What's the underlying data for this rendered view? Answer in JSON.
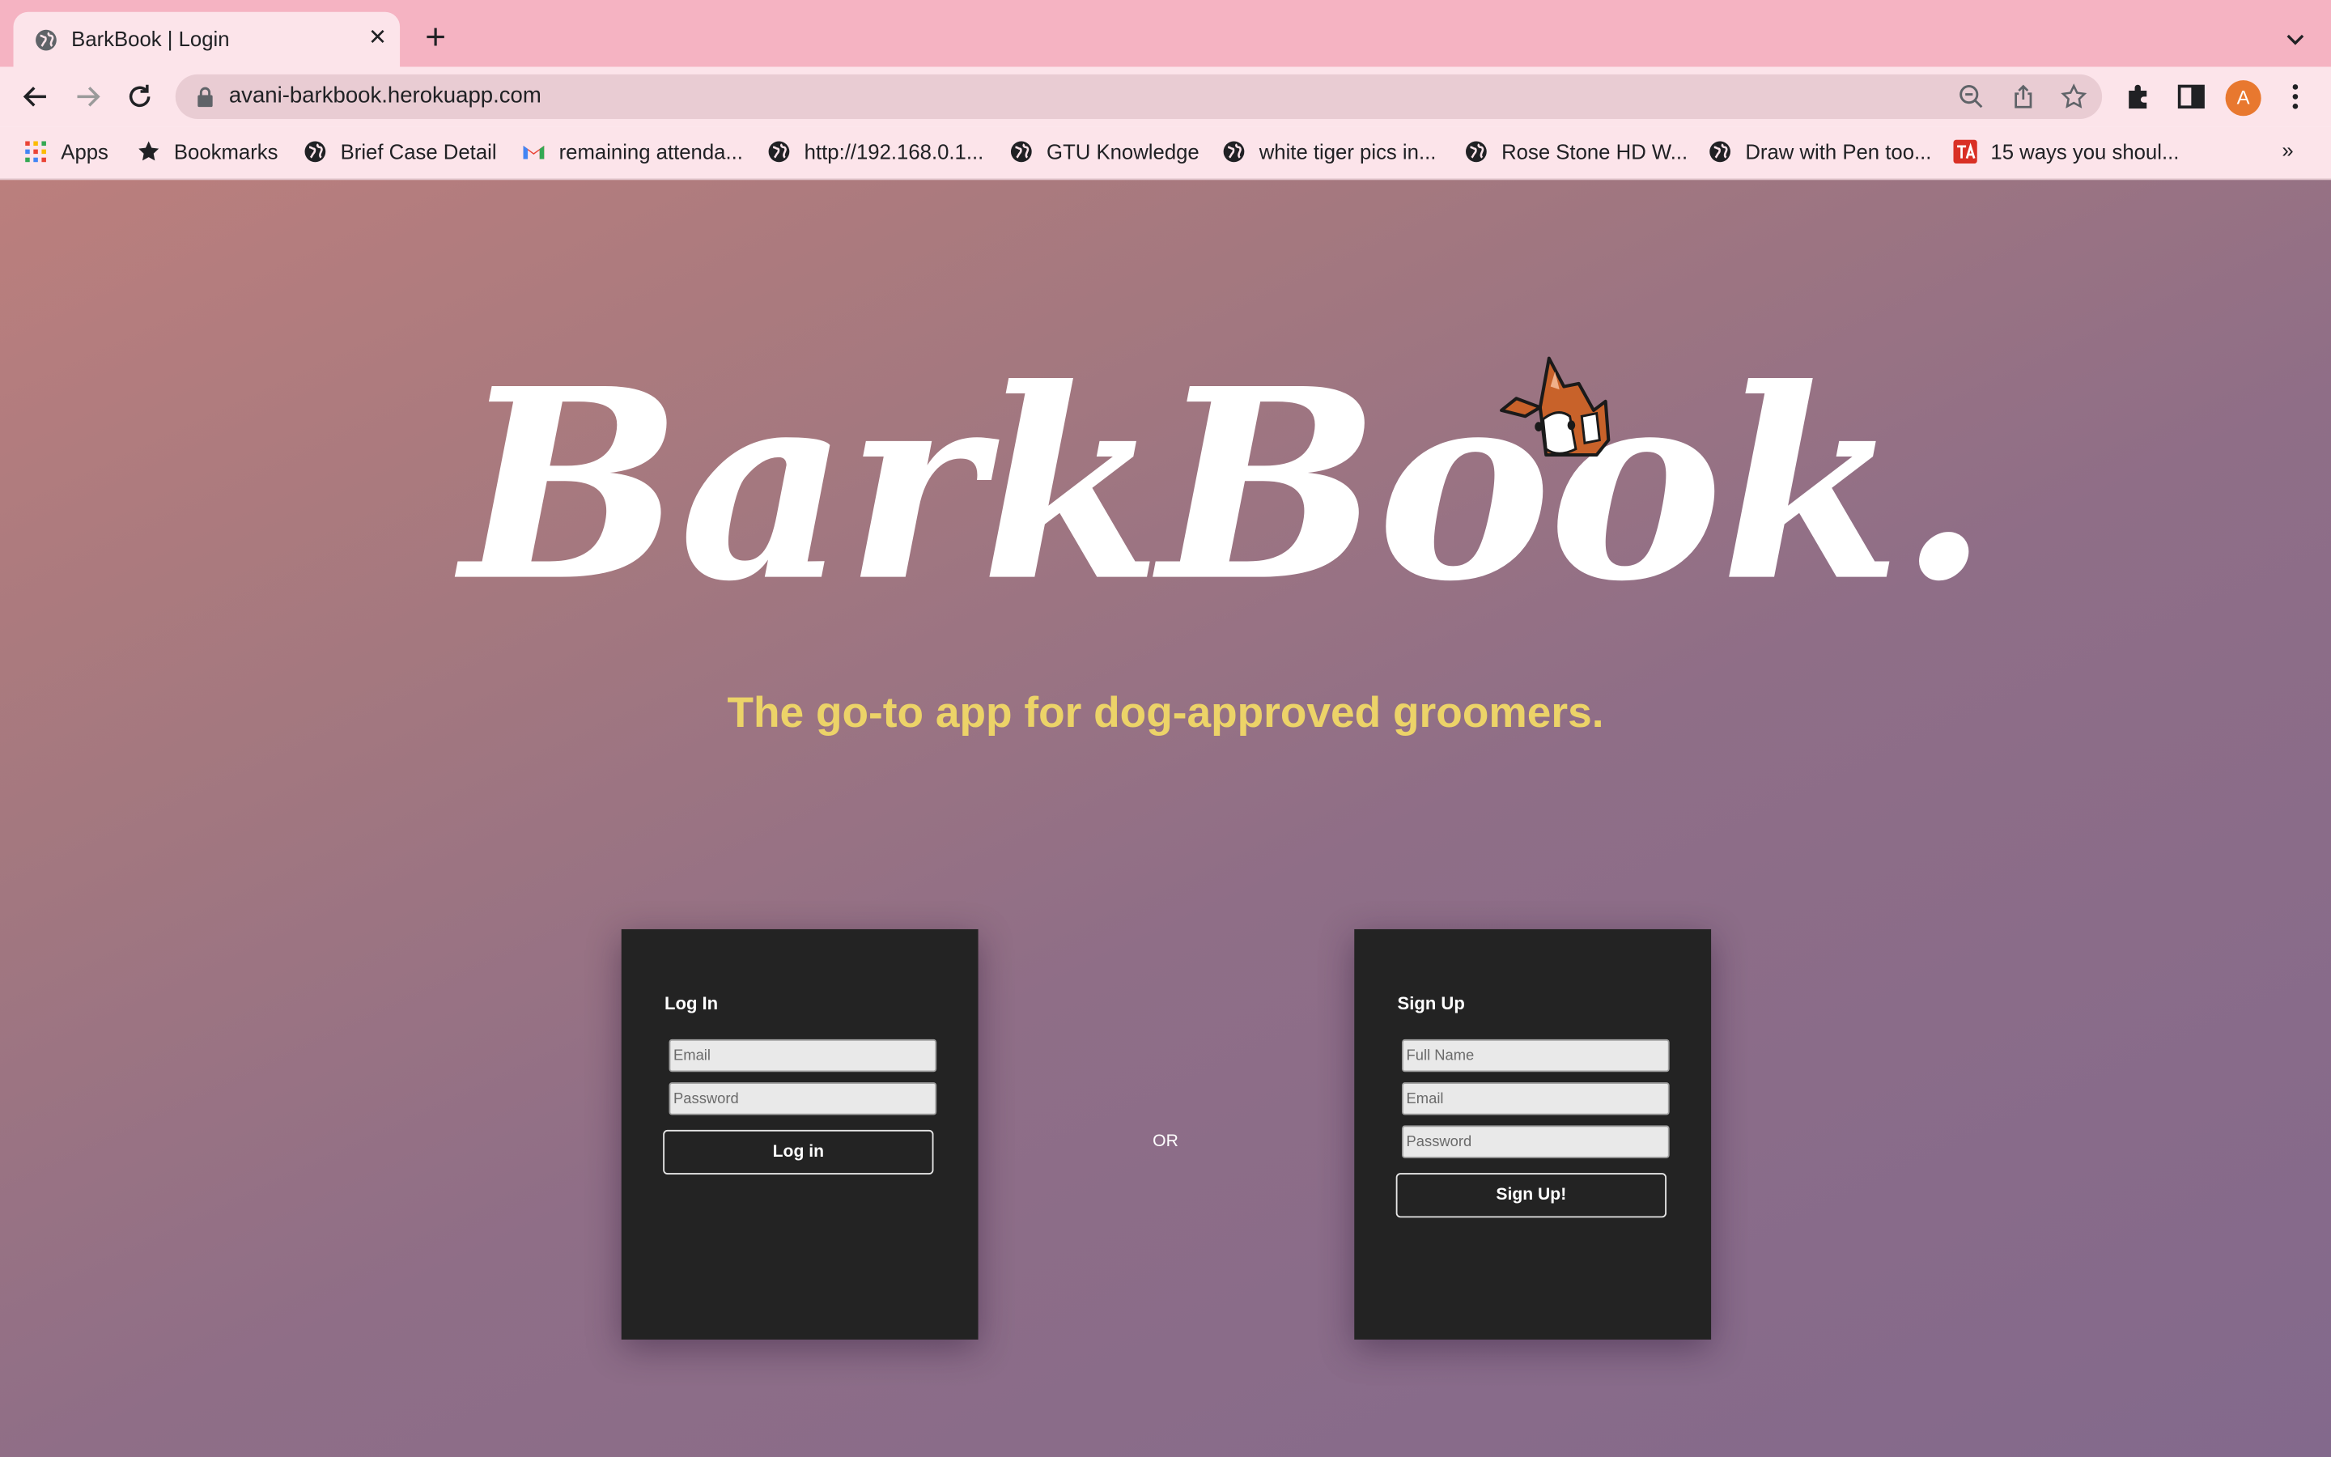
{
  "browser": {
    "tab_title": "BarkBook | Login",
    "url": "avani-barkbook.herokuapp.com",
    "profile_initial": "A",
    "bookmarks": [
      {
        "label": "Apps",
        "icon": "apps-grid-icon"
      },
      {
        "label": "Bookmarks",
        "icon": "star-icon"
      },
      {
        "label": "Brief Case Detail",
        "icon": "globe-icon"
      },
      {
        "label": "remaining attenda...",
        "icon": "gmail-icon"
      },
      {
        "label": "http://192.168.0.1...",
        "icon": "globe-icon"
      },
      {
        "label": "GTU Knowledge",
        "icon": "globe-icon"
      },
      {
        "label": "white tiger pics in...",
        "icon": "globe-icon"
      },
      {
        "label": "Rose Stone HD W...",
        "icon": "globe-icon"
      },
      {
        "label": "Draw with Pen too...",
        "icon": "globe-icon"
      },
      {
        "label": "15 ways you shoul...",
        "icon": "ta-icon"
      }
    ],
    "bookmarks_overflow": "»"
  },
  "page": {
    "logo": "BarkBook.",
    "tagline": "The go-to app for dog-approved groomers.",
    "or_label": "OR"
  },
  "login": {
    "title": "Log In",
    "email_placeholder": "Email",
    "password_placeholder": "Password",
    "submit_label": "Log in"
  },
  "signup": {
    "title": "Sign Up",
    "name_placeholder": "Full Name",
    "email_placeholder": "Email",
    "password_placeholder": "Password",
    "submit_label": "Sign Up!"
  },
  "colors": {
    "tab_strip": "#f5b3c2",
    "toolbar": "#fce4ea",
    "tagline": "#ecd368",
    "card": "#232323",
    "avatar": "#e8782f"
  }
}
